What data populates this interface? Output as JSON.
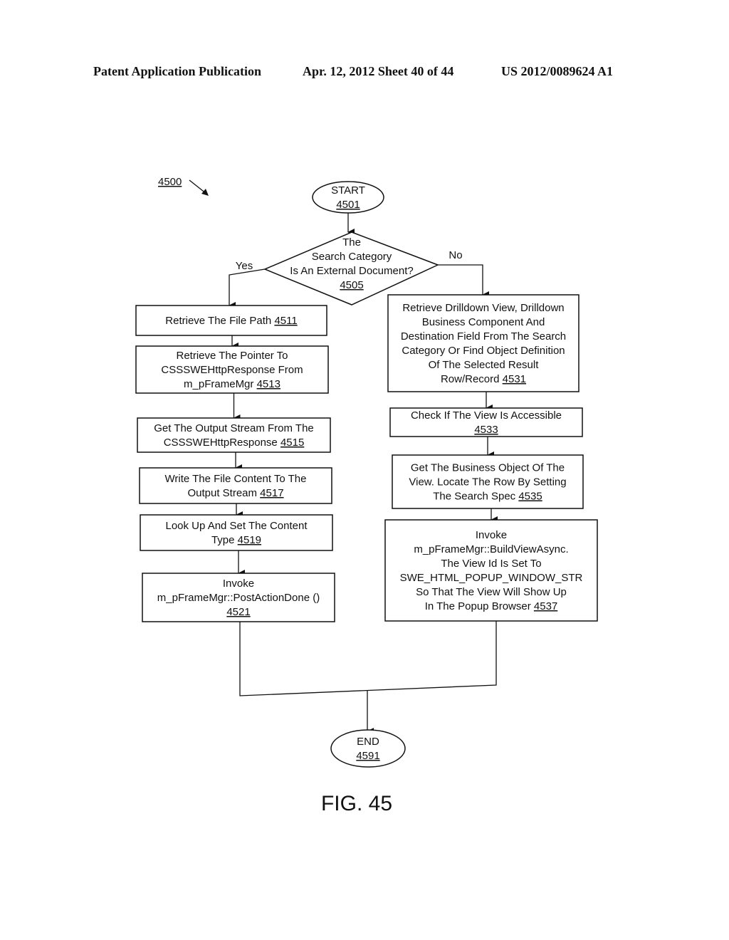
{
  "header": {
    "publication": "Patent Application Publication",
    "date_sheet": "Apr. 12, 2012  Sheet 40 of 44",
    "patent_number": "US 2012/0089624 A1"
  },
  "diagram": {
    "ref_label": "4500",
    "figure_label": "FIG. 45",
    "start": {
      "lines": [
        "START"
      ],
      "ref": "4501"
    },
    "decision": {
      "lines": [
        "The",
        "Search Category",
        "Is An External Document?"
      ],
      "ref": "4505",
      "yes_label": "Yes",
      "no_label": "No"
    },
    "left_steps": [
      {
        "lines": [
          "Retrieve The File Path"
        ],
        "ref": "4511"
      },
      {
        "lines": [
          "Retrieve The Pointer To",
          "CSSSWEHttpResponse From",
          "m_pFrameMgr"
        ],
        "ref": "4513"
      },
      {
        "lines": [
          "Get The Output Stream From The",
          "CSSSWEHttpResponse"
        ],
        "ref": "4515"
      },
      {
        "lines": [
          "Write The File Content To The",
          "Output Stream"
        ],
        "ref": "4517"
      },
      {
        "lines": [
          "Look Up And Set The Content",
          "Type"
        ],
        "ref": "4519"
      },
      {
        "lines": [
          "Invoke",
          "m_pFrameMgr::PostActionDone ()"
        ],
        "ref": "4521",
        "ref_own_line": true
      }
    ],
    "right_steps": [
      {
        "lines": [
          "Retrieve Drilldown View, Drilldown",
          "Business Component And",
          "Destination Field From The Search",
          "Category Or Find Object Definition",
          "Of The Selected Result",
          "Row/Record"
        ],
        "ref": "4531"
      },
      {
        "lines": [
          "Check If The View Is Accessible"
        ],
        "ref": "4533",
        "ref_own_line": true
      },
      {
        "lines": [
          "Get The Business Object Of The",
          "View.  Locate The Row By Setting",
          "The Search Spec"
        ],
        "ref": "4535"
      },
      {
        "lines": [
          "Invoke",
          "m_pFrameMgr::BuildViewAsync.",
          "The View Id Is Set To",
          "SWE_HTML_POPUP_WINDOW_STR",
          "So That The View Will Show Up",
          "In The Popup Browser"
        ],
        "ref": "4537"
      }
    ],
    "end": {
      "lines": [
        "END"
      ],
      "ref": "4591"
    }
  }
}
